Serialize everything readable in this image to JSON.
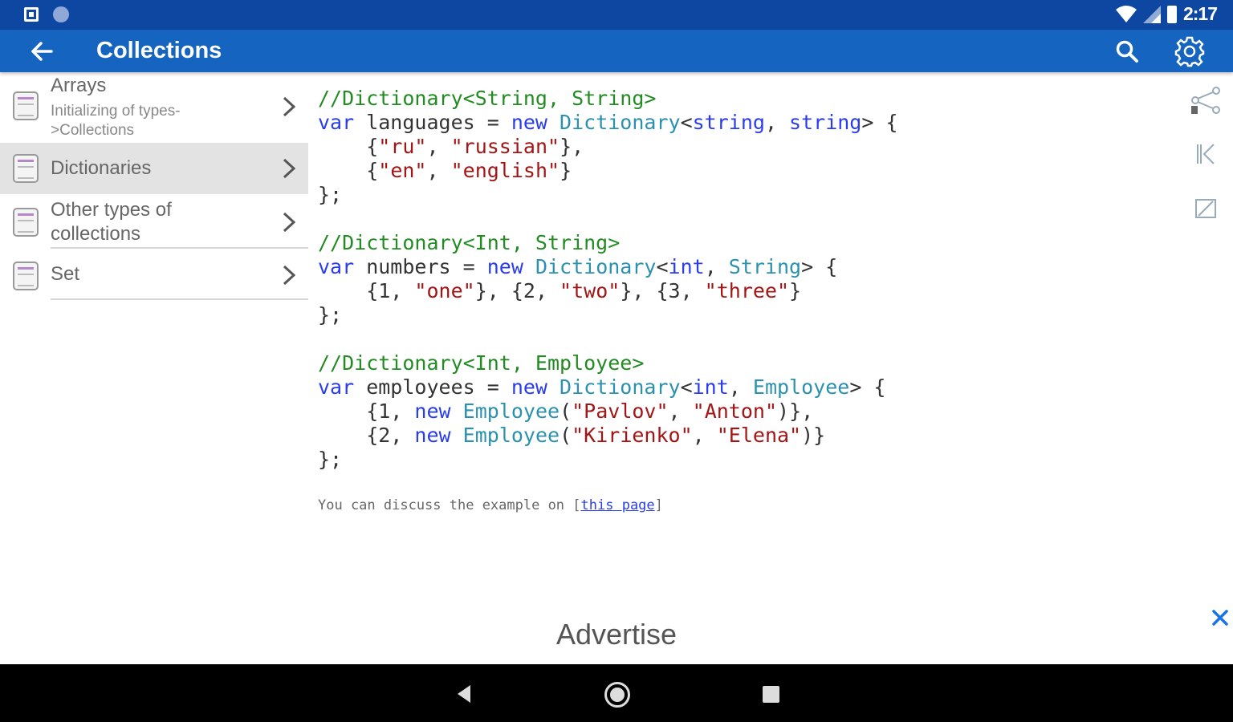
{
  "status_bar": {
    "time": "2:17"
  },
  "app_bar": {
    "title": "Collections"
  },
  "sidebar": {
    "items": [
      {
        "title": "Arrays",
        "subtitle": "Initializing of types->Collections"
      },
      {
        "title": "Dictionaries",
        "selected": true
      },
      {
        "title": "Other types of collections"
      },
      {
        "title": "Set"
      }
    ]
  },
  "code": {
    "l1": "//Dictionary<String, String>",
    "l2a": "var",
    "l2b": " languages = ",
    "l2c": "new",
    "l2d": " ",
    "l2e": "Dictionary",
    "l2f": "<",
    "l2g": "string",
    "l2h": ", ",
    "l2i": "string",
    "l2j": "> {",
    "l3a": "    {",
    "l3b": "\"ru\"",
    "l3c": ", ",
    "l3d": "\"russian\"",
    "l3e": "},",
    "l4a": "    {",
    "l4b": "\"en\"",
    "l4c": ", ",
    "l4d": "\"english\"",
    "l4e": "}",
    "l5": "};",
    "l7": "//Dictionary<Int, String>",
    "l8a": "var",
    "l8b": " numbers = ",
    "l8c": "new",
    "l8d": " ",
    "l8e": "Dictionary",
    "l8f": "<",
    "l8g": "int",
    "l8h": ", ",
    "l8i": "String",
    "l8j": "> {",
    "l9a": "    {1, ",
    "l9b": "\"one\"",
    "l9c": "}, {2, ",
    "l9d": "\"two\"",
    "l9e": "}, {3, ",
    "l9f": "\"three\"",
    "l9g": "}",
    "l10": "};",
    "l12": "//Dictionary<Int, Employee>",
    "l13a": "var",
    "l13b": " employees = ",
    "l13c": "new",
    "l13d": " ",
    "l13e": "Dictionary",
    "l13f": "<",
    "l13g": "int",
    "l13h": ", ",
    "l13i": "Employee",
    "l13j": "> {",
    "l14a": "    {1, ",
    "l14b": "new",
    "l14c": " ",
    "l14d": "Employee",
    "l14e": "(",
    "l14f": "\"Pavlov\"",
    "l14g": ", ",
    "l14h": "\"Anton\"",
    "l14i": ")},",
    "l15a": "    {2, ",
    "l15b": "new",
    "l15c": " ",
    "l15d": "Employee",
    "l15e": "(",
    "l15f": "\"Kirienko\"",
    "l15g": ", ",
    "l15h": "\"Elena\"",
    "l15i": ")}",
    "l16": "};"
  },
  "discuss": {
    "prefix": "You can discuss the example on ",
    "open": "[",
    "link": "this page",
    "close": "]"
  },
  "advertise": "Advertise",
  "colors": {
    "status_bar": "#0d47a1",
    "app_bar": "#1565c0",
    "comment": "#228b22",
    "keyword": "#2a3cf0",
    "type": "#2b91af",
    "string": "#a31515"
  },
  "icons": [
    "back-arrow-icon",
    "search-icon",
    "gear-icon",
    "share-icon",
    "first-page-icon",
    "edit-icon",
    "close-icon"
  ]
}
